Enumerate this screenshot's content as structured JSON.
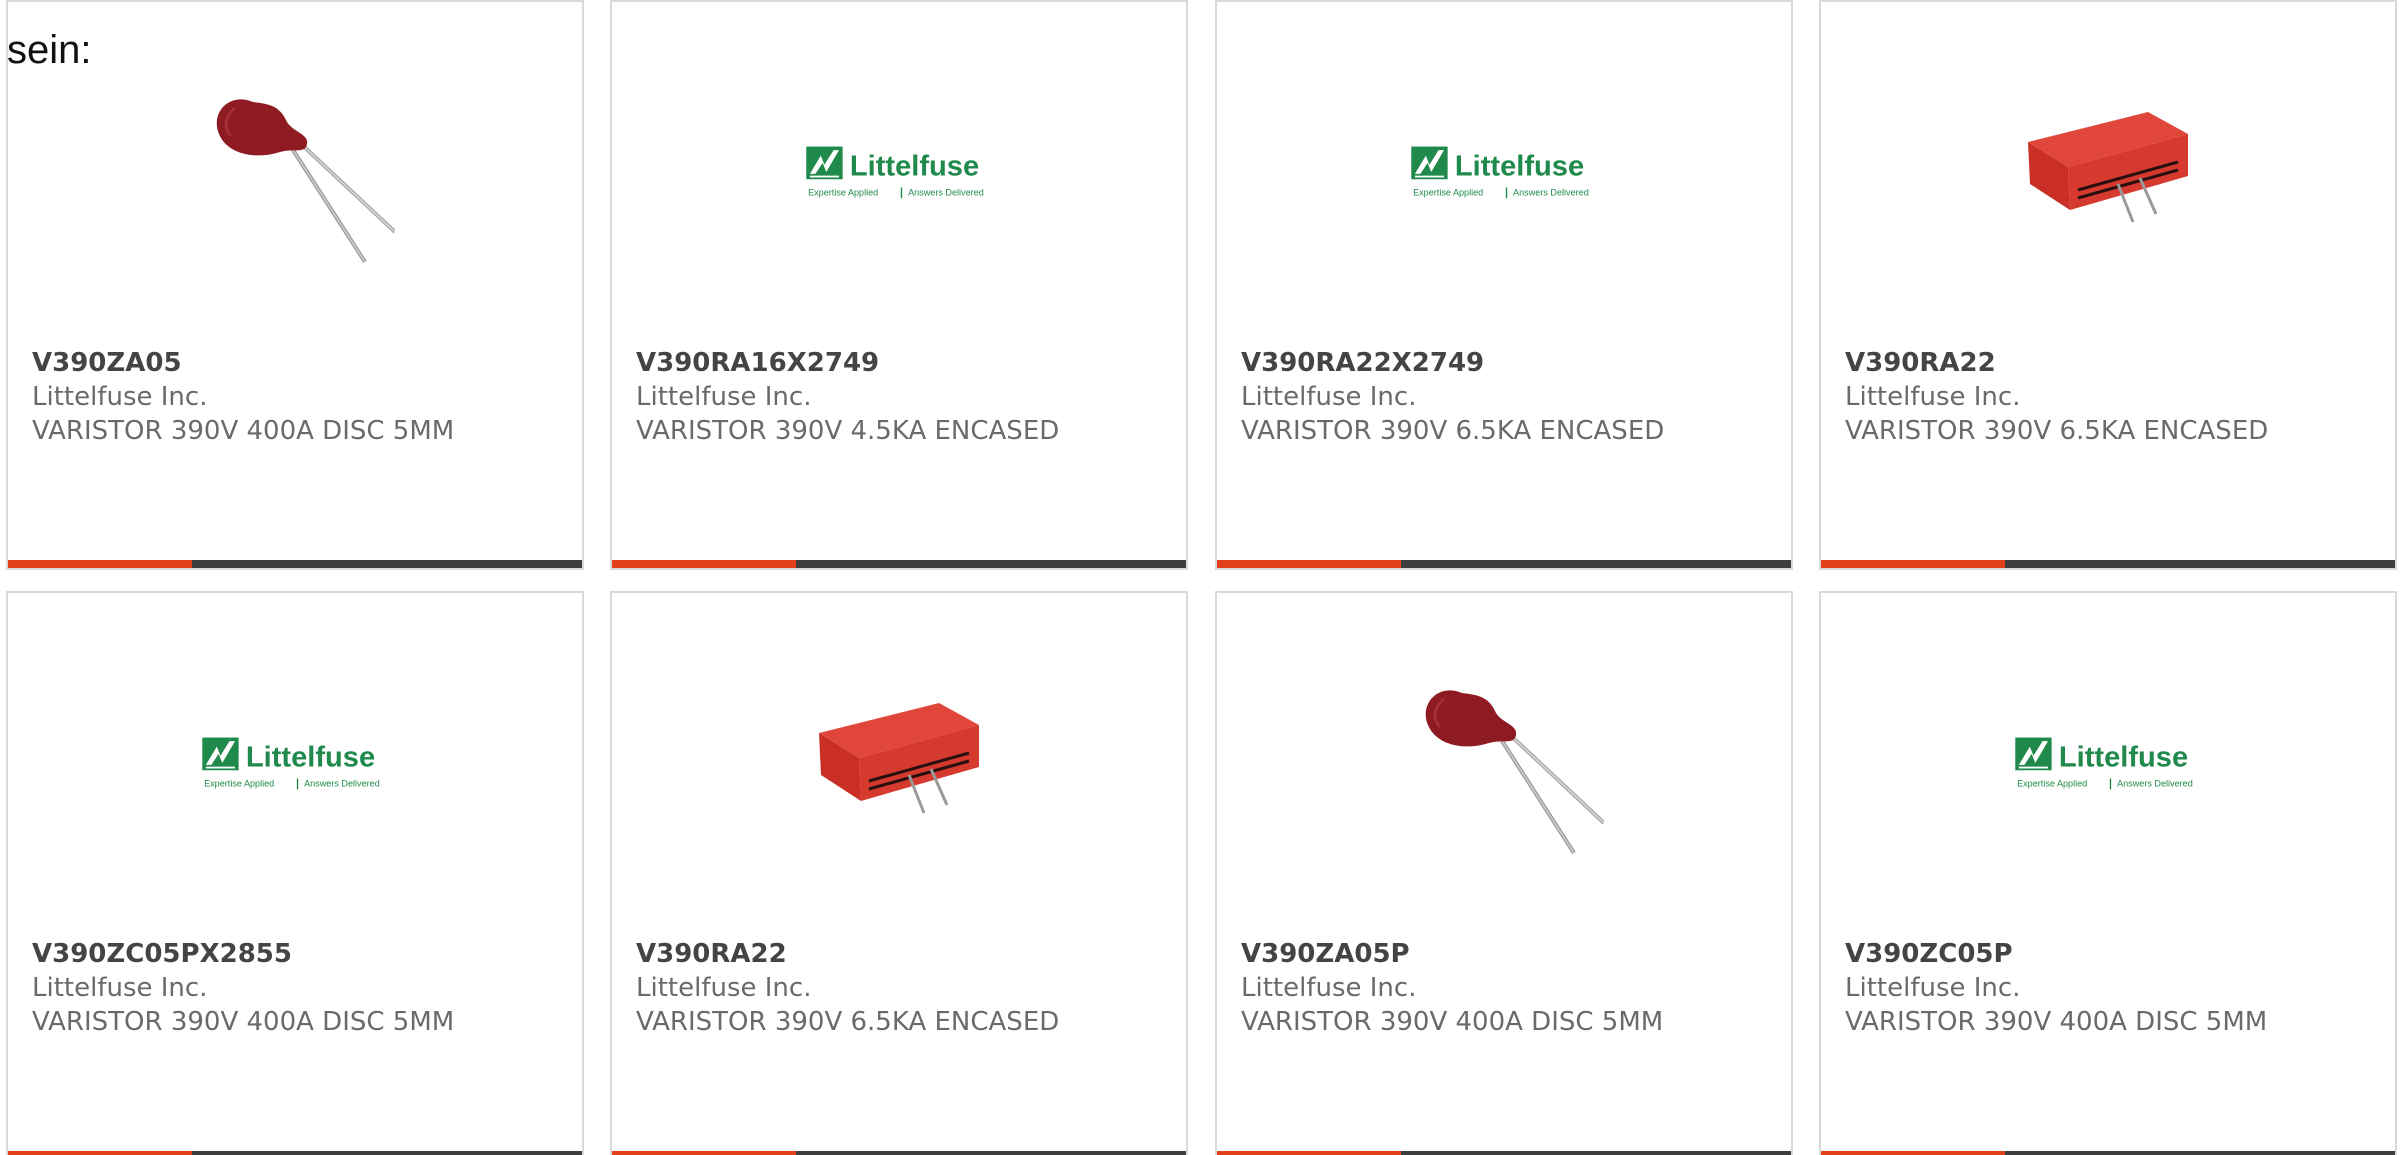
{
  "intro_text": "sein:",
  "colors": {
    "accent": "#e0401a",
    "bar_dark": "#3d3d3d",
    "logo_green": "#1f8a4c"
  },
  "logo": {
    "name": "Littelfuse",
    "tagline_left": "Expertise Applied",
    "tagline_right": "Answers Delivered"
  },
  "products": [
    {
      "part_number": "V390ZA05",
      "manufacturer": "Littelfuse Inc.",
      "description": "VARISTOR 390V 400A DISC 5MM",
      "image": "disc-varistor"
    },
    {
      "part_number": "V390RA16X2749",
      "manufacturer": "Littelfuse Inc.",
      "description": "VARISTOR 390V 4.5KA ENCASED",
      "image": "littelfuse-logo"
    },
    {
      "part_number": "V390RA22X2749",
      "manufacturer": "Littelfuse Inc.",
      "description": "VARISTOR 390V 6.5KA ENCASED",
      "image": "littelfuse-logo"
    },
    {
      "part_number": "V390RA22",
      "manufacturer": "Littelfuse Inc.",
      "description": "VARISTOR 390V 6.5KA ENCASED",
      "image": "encased-varistor"
    },
    {
      "part_number": "V390ZC05PX2855",
      "manufacturer": "Littelfuse Inc.",
      "description": "VARISTOR 390V 400A DISC 5MM",
      "image": "littelfuse-logo"
    },
    {
      "part_number": "V390RA22",
      "manufacturer": "Littelfuse Inc.",
      "description": "VARISTOR 390V 6.5KA ENCASED",
      "image": "encased-varistor"
    },
    {
      "part_number": "V390ZA05P",
      "manufacturer": "Littelfuse Inc.",
      "description": "VARISTOR 390V 400A DISC 5MM",
      "image": "disc-varistor"
    },
    {
      "part_number": "V390ZC05P",
      "manufacturer": "Littelfuse Inc.",
      "description": "VARISTOR 390V 400A DISC 5MM",
      "image": "littelfuse-logo"
    }
  ]
}
